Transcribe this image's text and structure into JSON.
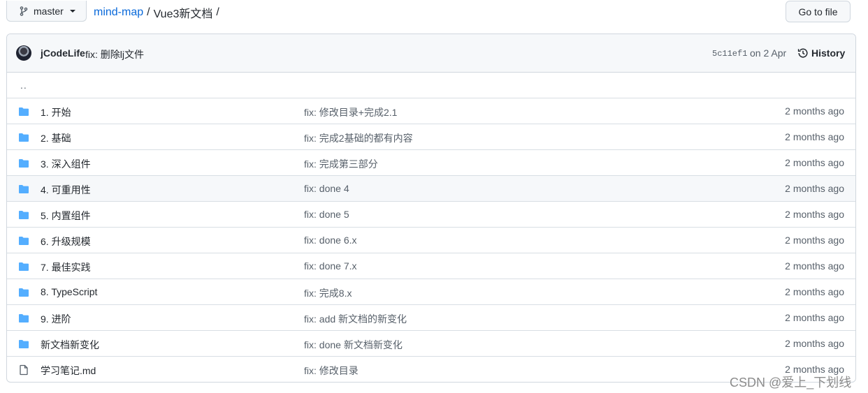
{
  "branch": {
    "name": "master",
    "icon": "git-branch-icon"
  },
  "breadcrumb": {
    "repo": "mind-map",
    "separator": "/",
    "current": "Vue3新文档",
    "trailing": "/"
  },
  "goto_file": {
    "label": "Go to file"
  },
  "commit": {
    "author": "jCodeLife",
    "message": "fix: 删除lj文件",
    "sha": "5c11ef1",
    "date": "on 2 Apr",
    "history_label": "History"
  },
  "parent_dir": "..",
  "files": [
    {
      "type": "folder",
      "name": "1. 开始",
      "message": "fix: 修改目录+完成2.1",
      "age": "2 months ago"
    },
    {
      "type": "folder",
      "name": "2. 基础",
      "message": "fix: 完成2基础的都有内容",
      "age": "2 months ago"
    },
    {
      "type": "folder",
      "name": "3. 深入组件",
      "message": "fix: 完成第三部分",
      "age": "2 months ago"
    },
    {
      "type": "folder",
      "name": "4. 可重用性",
      "message": "fix: done 4",
      "age": "2 months ago"
    },
    {
      "type": "folder",
      "name": "5. 内置组件",
      "message": "fix: done 5",
      "age": "2 months ago"
    },
    {
      "type": "folder",
      "name": "6. 升级规模",
      "message": "fix: done 6.x",
      "age": "2 months ago"
    },
    {
      "type": "folder",
      "name": "7. 最佳实践",
      "message": "fix: done 7.x",
      "age": "2 months ago"
    },
    {
      "type": "folder",
      "name": "8. TypeScript",
      "message": "fix: 完成8.x",
      "age": "2 months ago"
    },
    {
      "type": "folder",
      "name": "9. 进阶",
      "message": "fix: add 新文档的新变化",
      "age": "2 months ago"
    },
    {
      "type": "folder",
      "name": "新文档新变化",
      "message": "fix: done 新文档新变化",
      "age": "2 months ago"
    },
    {
      "type": "file",
      "name": "学习笔记.md",
      "message": "fix: 修改目录",
      "age": "2 months ago"
    }
  ],
  "colors": {
    "folder": "#54aeff",
    "link": "#0969da",
    "muted": "#57606a"
  },
  "watermark": "CSDN @爱上_下划线"
}
